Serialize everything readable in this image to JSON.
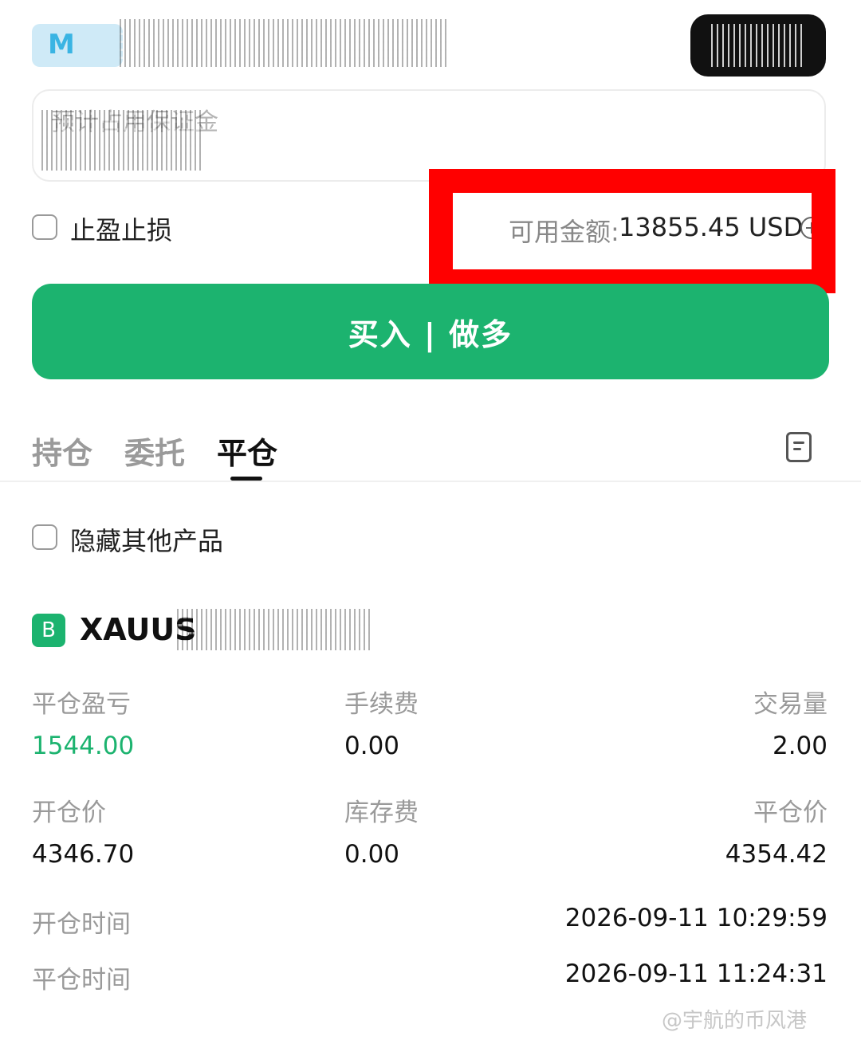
{
  "margin_field": {
    "placeholder": "预计占用保证金"
  },
  "tpsl": {
    "label": "止盈止损"
  },
  "available": {
    "label": "可用金额:",
    "value": "13855.45 USD"
  },
  "buy_button": {
    "label": "买入 | 做多"
  },
  "tabs": [
    {
      "label": "持仓",
      "active": false
    },
    {
      "label": "委托",
      "active": false
    },
    {
      "label": "平仓",
      "active": true
    }
  ],
  "hide_others": {
    "label": "隐藏其他产品"
  },
  "product": {
    "badge": "B",
    "symbol": "XAUUS"
  },
  "details": {
    "pnl_label": "平仓盈亏",
    "pnl_value": "1544.00",
    "fee_label": "手续费",
    "fee_value": "0.00",
    "volume_label": "交易量",
    "volume_value": "2.00",
    "open_price_label": "开仓价",
    "open_price_value": "4346.70",
    "swap_label": "库存费",
    "swap_value": "0.00",
    "close_price_label": "平仓价",
    "close_price_value": "4354.42",
    "open_time_label": "开仓时间",
    "open_time_value": "2026-09-11 10:29:59",
    "close_time_label": "平仓时间",
    "close_time_value": "2026-09-11 11:24:31"
  },
  "watermark": "@宇航的币风港",
  "colors": {
    "accent_green": "#1cb36f",
    "highlight_red": "#ff0000"
  },
  "icons": [
    "plus-circle-icon",
    "document-icon"
  ]
}
